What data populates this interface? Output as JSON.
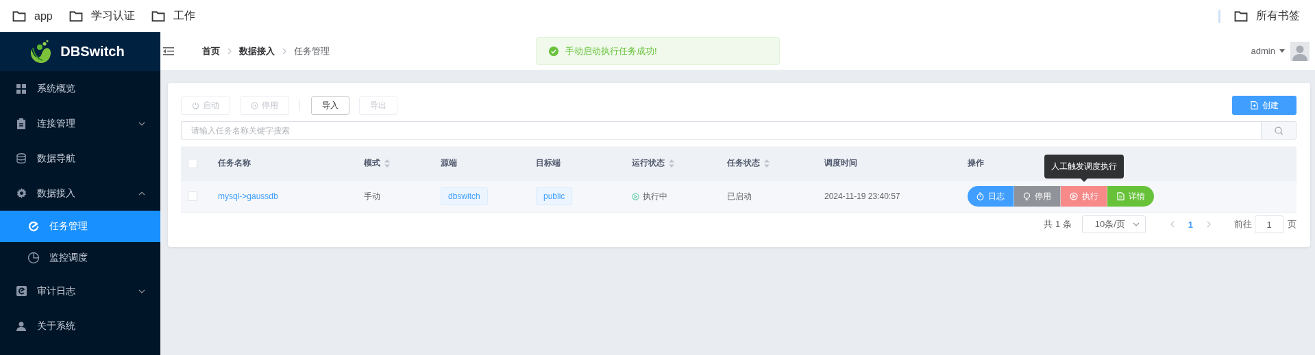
{
  "bookmarks": {
    "items": [
      {
        "label": "app"
      },
      {
        "label": "学习认证"
      },
      {
        "label": "工作"
      }
    ],
    "all": "所有书签"
  },
  "sidebar": {
    "logo": "DBSwitch",
    "items": [
      {
        "label": "系统概览",
        "selected": false
      },
      {
        "label": "连接管理",
        "selected": false,
        "expanded": false
      },
      {
        "label": "数据导航",
        "selected": false
      },
      {
        "label": "数据接入",
        "selected": false,
        "expanded": true,
        "children": [
          {
            "label": "任务管理",
            "selected": true
          },
          {
            "label": "监控调度",
            "selected": false
          }
        ]
      },
      {
        "label": "审计日志",
        "selected": false,
        "expanded": false
      },
      {
        "label": "关于系统",
        "selected": false
      }
    ]
  },
  "header": {
    "breadcrumb": [
      "首页",
      "数据接入",
      "任务管理"
    ],
    "user": "admin"
  },
  "toast": {
    "message": "手动启动执行任务成功!"
  },
  "toolbar": {
    "buttons": [
      {
        "label": "启动",
        "disabled": true
      },
      {
        "label": "停用",
        "disabled": true
      },
      {
        "label": "导入",
        "disabled": false
      },
      {
        "label": "导出",
        "disabled": true
      }
    ],
    "create": "创建"
  },
  "search": {
    "placeholder": "请输入任务名称关键字搜索"
  },
  "table": {
    "all_checked": false,
    "columns": [
      {
        "label": "任务名称",
        "sortable": false
      },
      {
        "label": "模式",
        "sortable": true
      },
      {
        "label": "源端",
        "sortable": false
      },
      {
        "label": "目标端",
        "sortable": false
      },
      {
        "label": "运行状态",
        "sortable": true
      },
      {
        "label": "任务状态",
        "sortable": true
      },
      {
        "label": "调度时间",
        "sortable": false
      },
      {
        "label": "操作",
        "sortable": false
      }
    ],
    "rows": [
      {
        "checked": false,
        "name": "mysql->gaussdb",
        "mode": "手动",
        "source": "dbswitch",
        "target": "public",
        "run_status": "执行中",
        "task_status": "已启动",
        "schedule_time": "2024-11-19 23:40:57",
        "actions": [
          {
            "label": "日志",
            "kind": "log"
          },
          {
            "label": "停用",
            "kind": "stop"
          },
          {
            "label": "执行",
            "kind": "run",
            "tooltip": "人工触发调度执行"
          },
          {
            "label": "详情",
            "kind": "detail"
          }
        ]
      }
    ]
  },
  "pagination": {
    "total": "共 1 条",
    "page_size": "10条/页",
    "pages": [
      {
        "label": "1",
        "selected": true
      }
    ],
    "goto_label": "前往",
    "goto_value": "1",
    "page_unit": "页"
  }
}
